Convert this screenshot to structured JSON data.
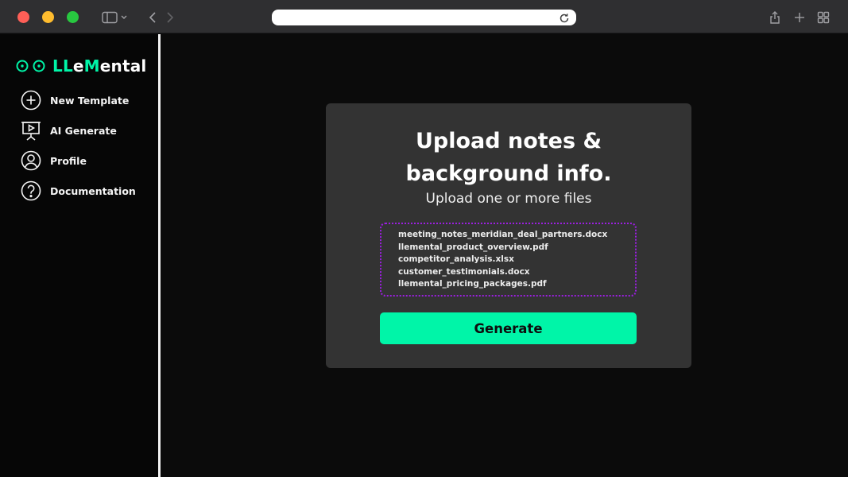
{
  "brand": {
    "name_parts": [
      {
        "text": "LL",
        "accent": true
      },
      {
        "text": "e",
        "accent": false
      },
      {
        "text": "M",
        "accent": true
      },
      {
        "text": "ental",
        "accent": false
      }
    ],
    "logo": "eyes-logo"
  },
  "sidebar": {
    "items": [
      {
        "label": "New Template",
        "icon": "plus-circle-icon"
      },
      {
        "label": "AI Generate",
        "icon": "presentation-icon"
      },
      {
        "label": "Profile",
        "icon": "user-icon"
      },
      {
        "label": "Documentation",
        "icon": "help-circle-icon"
      }
    ]
  },
  "upload": {
    "title_line1": "Upload notes &",
    "title_line2": "background info.",
    "subtitle": "Upload one or more files",
    "files": [
      "meeting_notes_meridian_deal_partners.docx",
      "llemental_product_overview.pdf",
      "competitor_analysis.xlsx",
      "customer_testimonials.docx",
      "llemental_pricing_packages.pdf"
    ],
    "generate_label": "Generate"
  },
  "colors": {
    "accent": "#00f5a8",
    "dropzone_border": "#9b1fe0",
    "card_bg": "#333333",
    "page_bg": "#0b0b0b",
    "sidebar_bg": "#060606"
  },
  "browser": {
    "address_value": "",
    "icons": [
      "sidebar-toggle-icon",
      "chevron-left-icon",
      "chevron-right-icon",
      "reload-icon",
      "share-icon",
      "plus-icon",
      "tab-overview-icon"
    ]
  }
}
